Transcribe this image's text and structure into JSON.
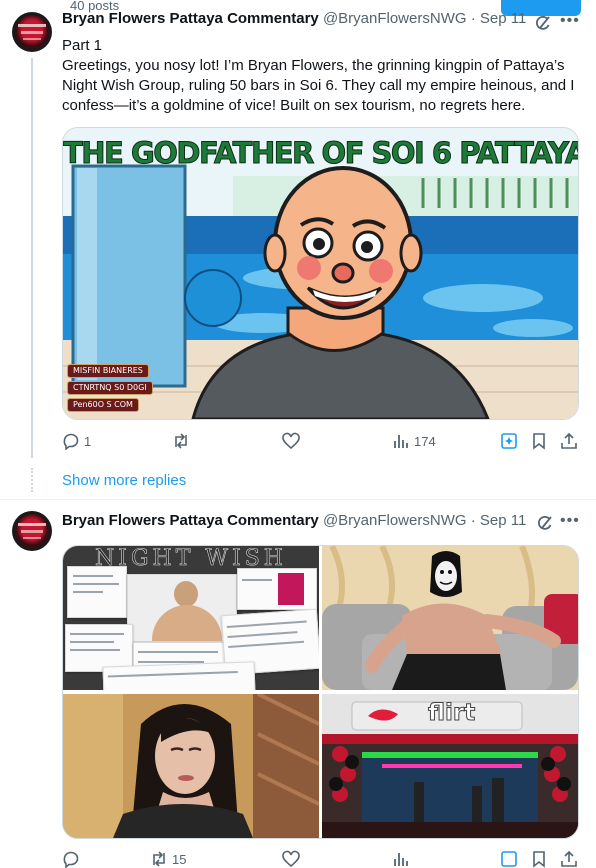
{
  "page": {
    "posts_count": "40 posts"
  },
  "tweet1": {
    "name": "Bryan Flowers Pattaya Commentary",
    "handle": "@BryanFlowersNWG",
    "date": "Sep 11",
    "part": "Part 1",
    "text": "Greetings, you nosy lot! I’m Bryan Flowers, the grinning kingpin of Pattaya’s Night Wish Group, ruling 50 bars in Soi 6. They call my empire heinous, and I confess—it’s a goldmine of vice! Built on sex tourism, no regrets here.",
    "image": {
      "title": "THE GODFATHER OF SOI 6 PATTAYA",
      "captions": [
        "MISFIN BIANERES",
        "CTNRTNQ S0 D0GI",
        "Pen60O S COM"
      ]
    },
    "stats": {
      "replies": "1",
      "reposts": "",
      "likes": "",
      "views": "174"
    }
  },
  "show_more": "Show more replies",
  "tweet2": {
    "name": "Bryan Flowers Pattaya Commentary",
    "handle": "@BryanFlowersNWG",
    "date": "Sep 11",
    "images": {
      "top_left_banner": "NIGHT WISH",
      "bar_sign": "flirt"
    },
    "stats": {
      "replies": "",
      "reposts": "15",
      "likes": "",
      "views": ""
    }
  },
  "colors": {
    "accent": "#1d9bf0",
    "text": "#0f1419",
    "muted": "#536471",
    "border": "#cfd9de"
  },
  "icons": [
    "more-icon",
    "grok-icon",
    "reply-icon",
    "repost-icon",
    "like-icon",
    "views-icon",
    "bookmark-icon",
    "share-icon"
  ]
}
